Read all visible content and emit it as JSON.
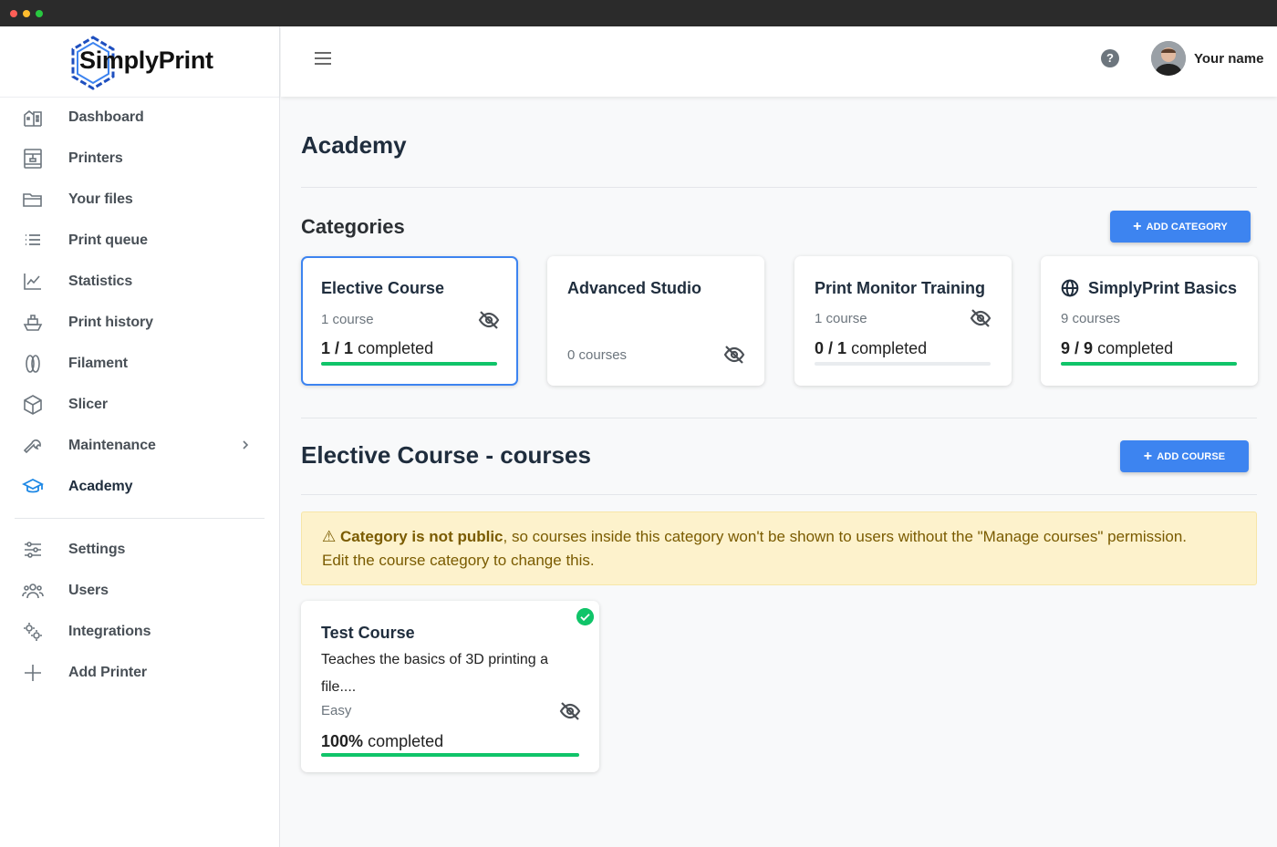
{
  "app": {
    "brand": "SimplyPrint",
    "brand_color": "#1e4fbf"
  },
  "topbar": {
    "help": "?",
    "username": "Your name"
  },
  "sidebar": {
    "items": [
      {
        "label": "Dashboard",
        "icon": "dashboard-icon"
      },
      {
        "label": "Printers",
        "icon": "printer-icon"
      },
      {
        "label": "Your files",
        "icon": "folder-icon"
      },
      {
        "label": "Print queue",
        "icon": "list-icon"
      },
      {
        "label": "Statistics",
        "icon": "chart-icon"
      },
      {
        "label": "Print history",
        "icon": "history-icon"
      },
      {
        "label": "Filament",
        "icon": "filament-icon"
      },
      {
        "label": "Slicer",
        "icon": "cube-icon"
      },
      {
        "label": "Maintenance",
        "icon": "wrench-icon"
      },
      {
        "label": "Academy",
        "icon": "graduation-cap-icon",
        "active": true
      }
    ],
    "items2": [
      {
        "label": "Settings",
        "icon": "sliders-icon"
      },
      {
        "label": "Users",
        "icon": "users-icon"
      },
      {
        "label": "Integrations",
        "icon": "gears-icon"
      },
      {
        "label": "Add Printer",
        "icon": "plus-icon"
      }
    ]
  },
  "main": {
    "title": "Academy",
    "categories_title": "Categories",
    "add_category": "Add category",
    "categories": [
      {
        "title": "Elective Course",
        "count": "1 course",
        "done": "1",
        "total": "1",
        "completed_label": "completed",
        "progress": 1.0,
        "hidden": true,
        "selected": true
      },
      {
        "title": "Advanced Studio",
        "count": "0 courses",
        "hidden": true
      },
      {
        "title": "Print Monitor Training",
        "count": "1 course",
        "done": "0",
        "total": "1",
        "completed_label": "completed",
        "progress": 0.0,
        "hidden": true
      },
      {
        "title": "SimplyPrint Basics",
        "count": "9 courses",
        "done": "9",
        "total": "9",
        "completed_label": "completed",
        "progress": 1.0,
        "public_icon": "globe-icon"
      }
    ],
    "courses_title": "Elective Course - courses",
    "add_course": "Add course",
    "warning": {
      "bold": "Category is not public",
      "text": ", so courses inside this category won't be shown to users without the \"Manage courses\" permission.",
      "line2": "Edit the course category to change this."
    },
    "course": {
      "title": "Test Course",
      "desc": "Teaches the basics of 3D printing a file....",
      "level": "Easy",
      "percent": "100%",
      "completed_label": "completed",
      "progress": 1.0
    }
  },
  "colors": {
    "accent": "#3d84f0",
    "success": "#10c469",
    "warning_bg": "#fdf2cc"
  }
}
